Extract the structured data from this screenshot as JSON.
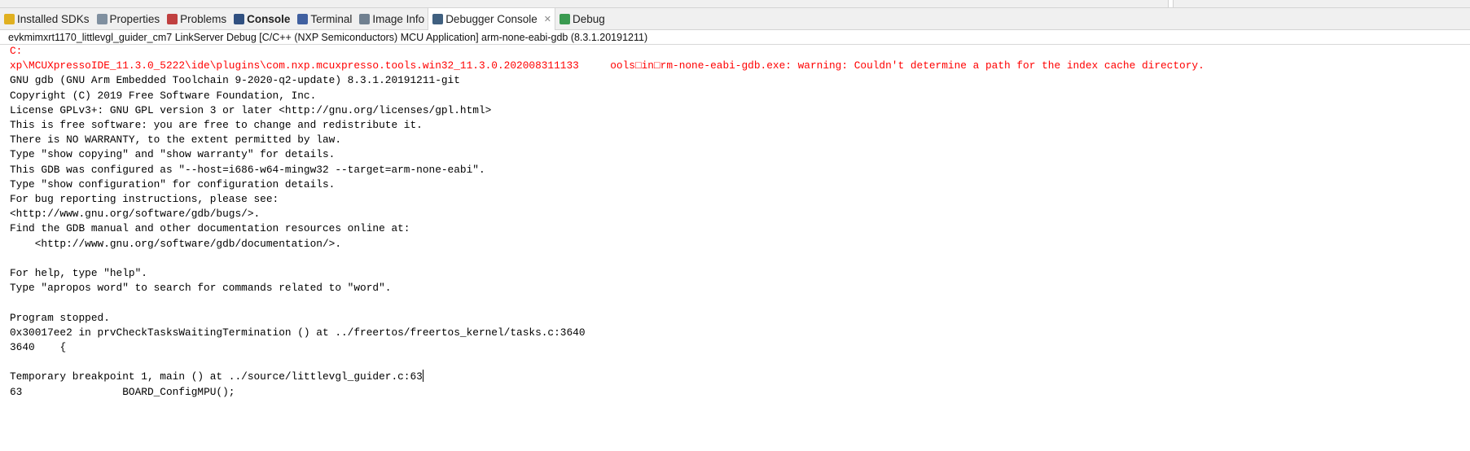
{
  "tabs": [
    {
      "label": "Installed SDKs",
      "icon": "sdk-icon",
      "color": "#e0b020"
    },
    {
      "label": "Properties",
      "icon": "properties-icon",
      "color": "#8090a0"
    },
    {
      "label": "Problems",
      "icon": "problems-icon",
      "color": "#c04040"
    },
    {
      "label": "Console",
      "icon": "console-icon",
      "color": "#305080"
    },
    {
      "label": "Terminal",
      "icon": "terminal-icon",
      "color": "#4060a0"
    },
    {
      "label": "Image Info",
      "icon": "image-info-icon",
      "color": "#708090"
    },
    {
      "label": "Debugger Console",
      "icon": "debugger-console-icon",
      "color": "#406080",
      "active": true
    },
    {
      "label": "Debug",
      "icon": "debug-icon",
      "color": "#3a9a50"
    }
  ],
  "close_glyph": "✕",
  "header": "evkmimxrt1170_littlevgl_guider_cm7 LinkServer Debug [C/C++ (NXP Semiconductors) MCU Application] arm-none-eabi-gdb (8.3.1.20191211)",
  "error_lines": [
    "C:",
    "xp\\MCUXpressoIDE_11.3.0_5222\\ide\\plugins\\com.nxp.mcuxpresso.tools.win32_11.3.0.202008311133     ools□in□rm-none-eabi-gdb.exe: warning: Couldn't determine a path for the index cache directory."
  ],
  "output_lines": [
    "GNU gdb (GNU Arm Embedded Toolchain 9-2020-q2-update) 8.3.1.20191211-git",
    "Copyright (C) 2019 Free Software Foundation, Inc.",
    "License GPLv3+: GNU GPL version 3 or later <http://gnu.org/licenses/gpl.html>",
    "This is free software: you are free to change and redistribute it.",
    "There is NO WARRANTY, to the extent permitted by law.",
    "Type \"show copying\" and \"show warranty\" for details.",
    "This GDB was configured as \"--host=i686-w64-mingw32 --target=arm-none-eabi\".",
    "Type \"show configuration\" for configuration details.",
    "For bug reporting instructions, please see:",
    "<http://www.gnu.org/software/gdb/bugs/>.",
    "Find the GDB manual and other documentation resources online at:",
    "    <http://www.gnu.org/software/gdb/documentation/>.",
    "",
    "For help, type \"help\".",
    "Type \"apropos word\" to search for commands related to \"word\".",
    "",
    "Program stopped.",
    "0x30017ee2 in prvCheckTasksWaitingTermination () at ../freertos/freertos_kernel/tasks.c:3640",
    "3640\t{",
    "",
    "Temporary breakpoint 1, main () at ../source/littlevgl_guider.c:63",
    "63\t\t  BOARD_ConfigMPU();"
  ]
}
